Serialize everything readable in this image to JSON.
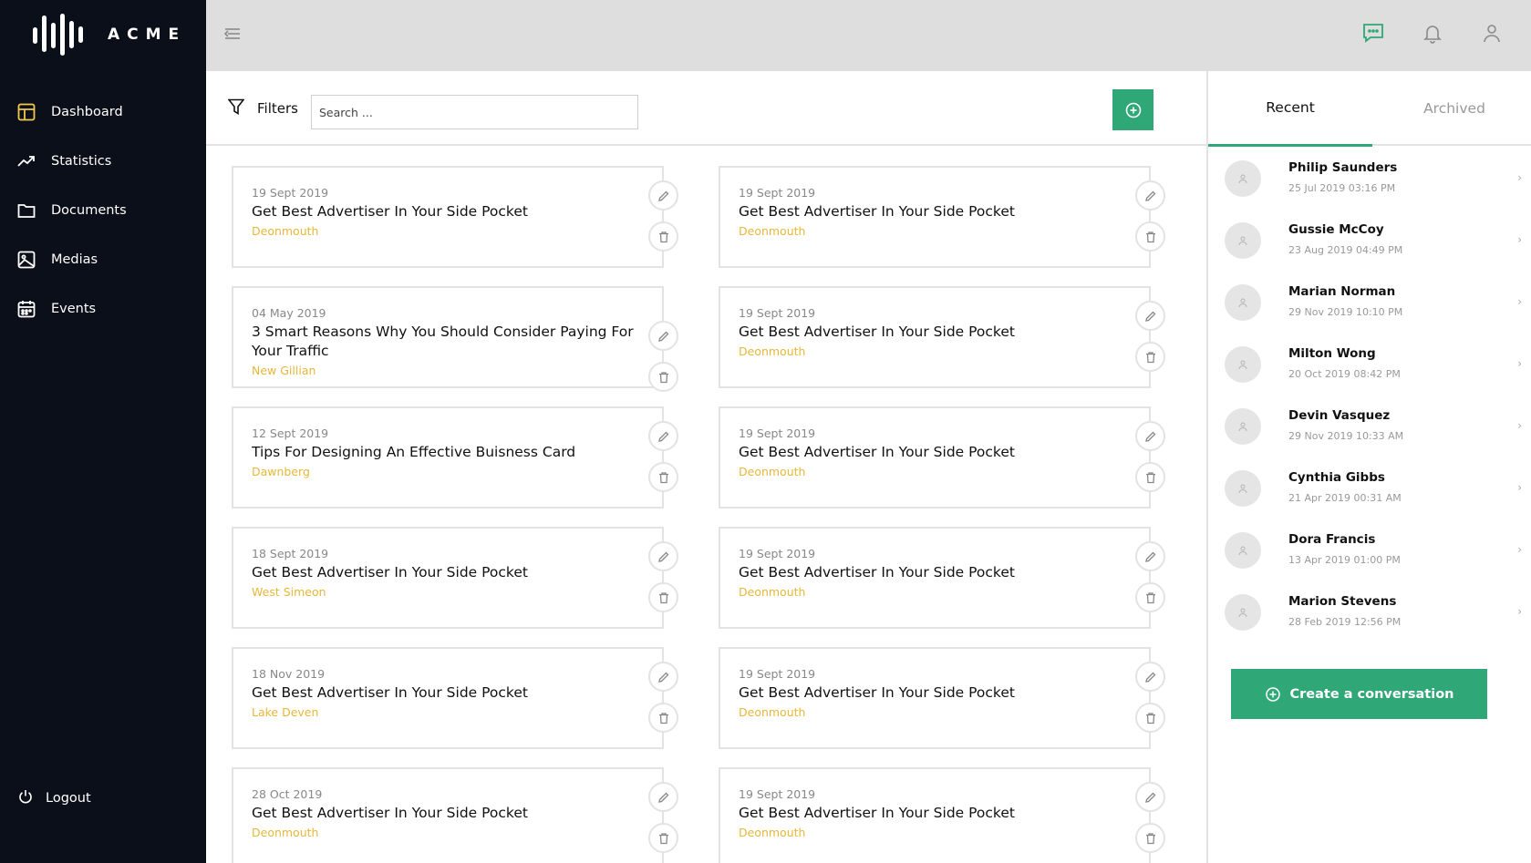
{
  "app": {
    "name": "ACME"
  },
  "sidebar": {
    "items": [
      {
        "label": "Dashboard",
        "icon": "dashboard-icon",
        "active": true
      },
      {
        "label": "Statistics",
        "icon": "trending-up-icon"
      },
      {
        "label": "Documents",
        "icon": "folder-icon"
      },
      {
        "label": "Medias",
        "icon": "image-icon"
      },
      {
        "label": "Events",
        "icon": "calendar-icon"
      }
    ],
    "logout_label": "Logout"
  },
  "header": {
    "icons": [
      "menu-collapse-icon",
      "chat-icon",
      "bell-icon",
      "user-icon"
    ]
  },
  "toolbar": {
    "filters_label": "Filters",
    "search_placeholder": "Search ..."
  },
  "cards": [
    {
      "date": "19 Sept 2019",
      "title": "Get Best Advertiser In Your Side Pocket",
      "location": "Deonmouth"
    },
    {
      "date": "19 Sept 2019",
      "title": "Get Best Advertiser In Your Side Pocket",
      "location": "Deonmouth"
    },
    {
      "date": "04 May 2019",
      "title": "3 Smart Reasons Why You Should Consider Paying For Your Traffic",
      "location": "New Gillian"
    },
    {
      "date": "19 Sept 2019",
      "title": "Get Best Advertiser In Your Side Pocket",
      "location": "Deonmouth"
    },
    {
      "date": "12 Sept 2019",
      "title": "Tips For Designing An Effective Buisness Card",
      "location": "Dawnberg"
    },
    {
      "date": "19 Sept 2019",
      "title": "Get Best Advertiser In Your Side Pocket",
      "location": "Deonmouth"
    },
    {
      "date": "18 Sept 2019",
      "title": "Get Best Advertiser In Your Side Pocket",
      "location": "West Simeon"
    },
    {
      "date": "19 Sept 2019",
      "title": "Get Best Advertiser In Your Side Pocket",
      "location": "Deonmouth"
    },
    {
      "date": "18 Nov 2019",
      "title": "Get Best Advertiser In Your Side Pocket",
      "location": "Lake Deven"
    },
    {
      "date": "19 Sept 2019",
      "title": "Get Best Advertiser In Your Side Pocket",
      "location": "Deonmouth"
    },
    {
      "date": "28 Oct 2019",
      "title": "Get Best Advertiser In Your Side Pocket",
      "location": "Deonmouth"
    },
    {
      "date": "19 Sept 2019",
      "title": "Get Best Advertiser In Your Side Pocket",
      "location": "Deonmouth"
    }
  ],
  "right_panel": {
    "tabs": [
      {
        "label": "Recent",
        "active": true
      },
      {
        "label": "Archived",
        "active": false
      }
    ],
    "conversations": [
      {
        "name": "Philip Saunders",
        "time": "25 Jul 2019 03:16 PM"
      },
      {
        "name": "Gussie McCoy",
        "time": "23 Aug 2019 04:49 PM"
      },
      {
        "name": "Marian Norman",
        "time": "29 Nov 2019 10:10 PM"
      },
      {
        "name": "Milton Wong",
        "time": "20 Oct 2019 08:42 PM"
      },
      {
        "name": "Devin Vasquez",
        "time": "29 Nov 2019 10:33 AM"
      },
      {
        "name": "Cynthia Gibbs",
        "time": "21 Apr 2019 00:31 AM"
      },
      {
        "name": "Dora Francis",
        "time": "13 Apr 2019 01:00 PM"
      },
      {
        "name": "Marion Stevens",
        "time": "28 Feb 2019 12:56 PM"
      }
    ],
    "create_label": "Create a conversation"
  },
  "colors": {
    "sidebar_bg": "#0b0f19",
    "accent_green": "#2fa776",
    "location_gold": "#e5b83a",
    "active_icon_yellow": "#f2c94c",
    "header_bg": "#dedede"
  }
}
